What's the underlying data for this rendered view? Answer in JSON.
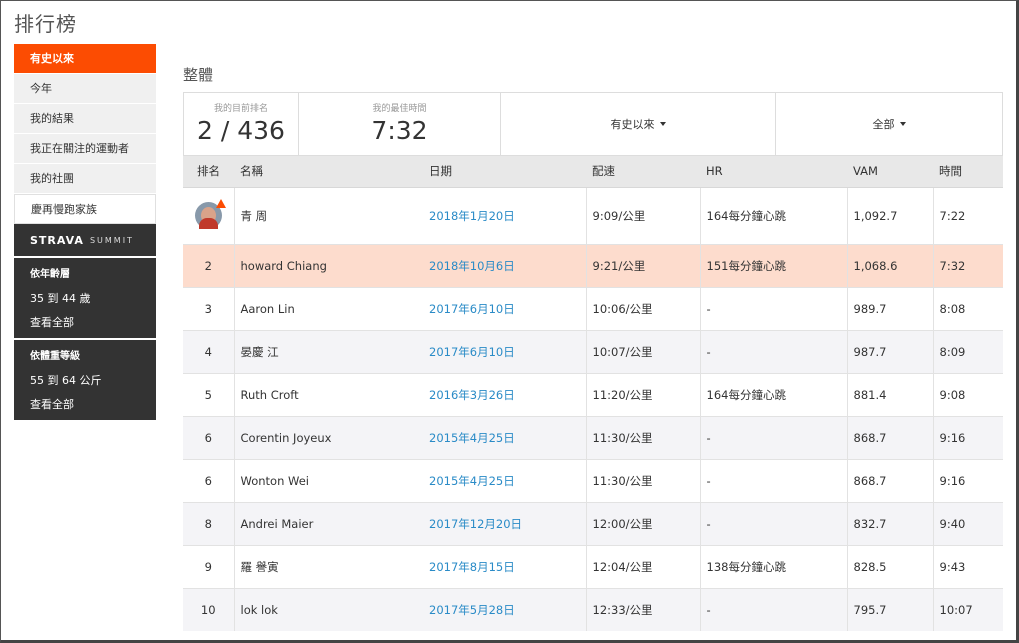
{
  "page": {
    "title": "排行榜"
  },
  "sidebar": {
    "items": [
      {
        "label": "有史以來",
        "active": true
      },
      {
        "label": "今年"
      },
      {
        "label": "我的結果"
      },
      {
        "label": "我正在關注的運動者"
      },
      {
        "label": "我的社團"
      },
      {
        "label": "慶再慢跑家族"
      }
    ],
    "summit": {
      "brand": "STRAVA",
      "sub": "SUMMIT"
    },
    "age": {
      "heading": "依年齡層",
      "value": "35 到 44 歲",
      "link": "查看全部"
    },
    "weight": {
      "heading": "依體重等級",
      "value": "55 到 64 公斤",
      "link": "查看全部"
    }
  },
  "main": {
    "section_title": "整體",
    "stats": {
      "rank_label": "我的目前排名",
      "rank_value": "2 / 436",
      "best_label": "我的最佳時間",
      "best_value": "7:32"
    },
    "filters": {
      "period": "有史以來",
      "scope": "全部"
    },
    "table": {
      "headers": {
        "rank": "排名",
        "name": "名稱",
        "date": "日期",
        "pace": "配速",
        "hr": "HR",
        "vam": "VAM",
        "time": "時間"
      },
      "rows": [
        {
          "rank": "",
          "name": "青 周",
          "date": "2018年1月20日",
          "pace": "9:09/公里",
          "hr": "164每分鐘心跳",
          "vam": "1,092.7",
          "time": "7:22"
        },
        {
          "rank": "2",
          "name": "howard Chiang",
          "date": "2018年10月6日",
          "pace": "9:21/公里",
          "hr": "151每分鐘心跳",
          "vam": "1,068.6",
          "time": "7:32"
        },
        {
          "rank": "3",
          "name": "Aaron Lin",
          "date": "2017年6月10日",
          "pace": "10:06/公里",
          "hr": "-",
          "vam": "989.7",
          "time": "8:08"
        },
        {
          "rank": "4",
          "name": "晏慶 江",
          "date": "2017年6月10日",
          "pace": "10:07/公里",
          "hr": "-",
          "vam": "987.7",
          "time": "8:09"
        },
        {
          "rank": "5",
          "name": "Ruth Croft",
          "date": "2016年3月26日",
          "pace": "11:20/公里",
          "hr": "164每分鐘心跳",
          "vam": "881.4",
          "time": "9:08"
        },
        {
          "rank": "6",
          "name": "Corentin Joyeux",
          "date": "2015年4月25日",
          "pace": "11:30/公里",
          "hr": "-",
          "vam": "868.7",
          "time": "9:16"
        },
        {
          "rank": "6",
          "name": "Wonton Wei",
          "date": "2015年4月25日",
          "pace": "11:30/公里",
          "hr": "-",
          "vam": "868.7",
          "time": "9:16"
        },
        {
          "rank": "8",
          "name": "Andrei Maier",
          "date": "2017年12月20日",
          "pace": "12:00/公里",
          "hr": "-",
          "vam": "832.7",
          "time": "9:40"
        },
        {
          "rank": "9",
          "name": "羅 譽寅",
          "date": "2017年8月15日",
          "pace": "12:04/公里",
          "hr": "138每分鐘心跳",
          "vam": "828.5",
          "time": "9:43"
        },
        {
          "rank": "10",
          "name": "lok lok",
          "date": "2017年5月28日",
          "pace": "12:33/公里",
          "hr": "-",
          "vam": "795.7",
          "time": "10:07"
        }
      ]
    }
  },
  "colors": {
    "accent": "#fc4c02",
    "highlight_row": "#fddccd",
    "link": "#2a8bc7",
    "dark_panel": "#333333"
  },
  "icons": {
    "first_place": "crown-avatar-icon",
    "dropdown": "caret-down-icon"
  }
}
